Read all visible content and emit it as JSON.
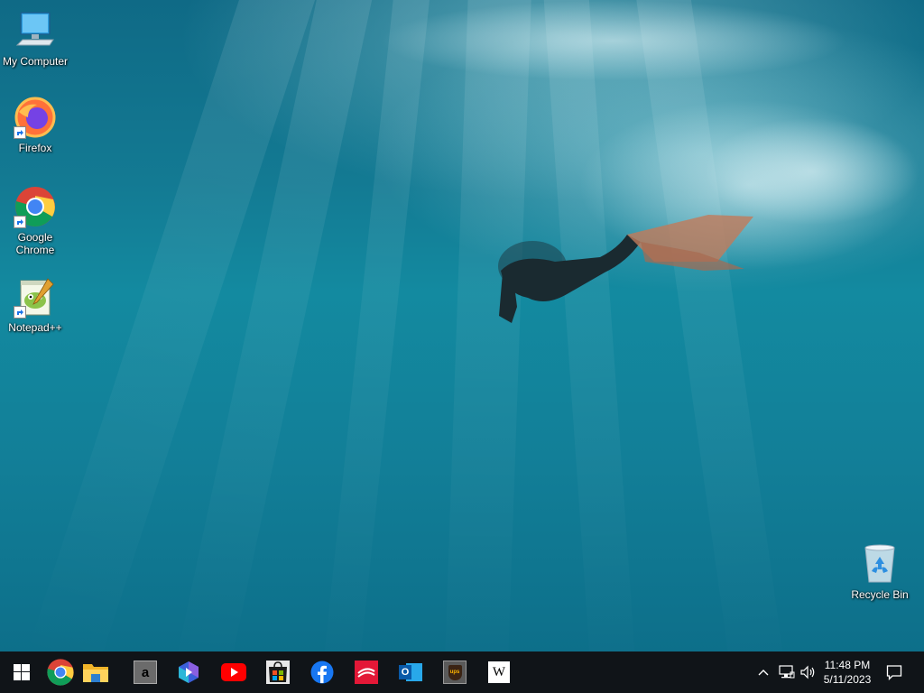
{
  "desktop": {
    "icons": [
      {
        "label": "My Computer",
        "icon": "monitor-icon"
      },
      {
        "label": "Firefox",
        "icon": "firefox-icon"
      },
      {
        "label": "Google Chrome",
        "icon": "chrome-icon"
      },
      {
        "label": "Notepad++",
        "icon": "notepadpp-icon"
      },
      {
        "label": "Recycle Bin",
        "icon": "recycle-bin-icon"
      }
    ]
  },
  "taskbar": {
    "pinned": [
      "windows-start-icon",
      "chrome-icon",
      "file-explorer-icon",
      "amazon-icon",
      "bing-icon",
      "youtube-icon",
      "microsoft-store-icon",
      "facebook-icon",
      "bank-of-america-icon",
      "outlook-icon",
      "ups-icon",
      "wikipedia-icon"
    ],
    "amazon_letter": "a",
    "outlook_letter": "O",
    "ups_text": "ups",
    "wikipedia_letter": "W"
  },
  "tray": {
    "time": "11:48 PM",
    "date": "5/11/2023"
  },
  "colors": {
    "taskbar": "#101418",
    "water": "#138aa0"
  }
}
